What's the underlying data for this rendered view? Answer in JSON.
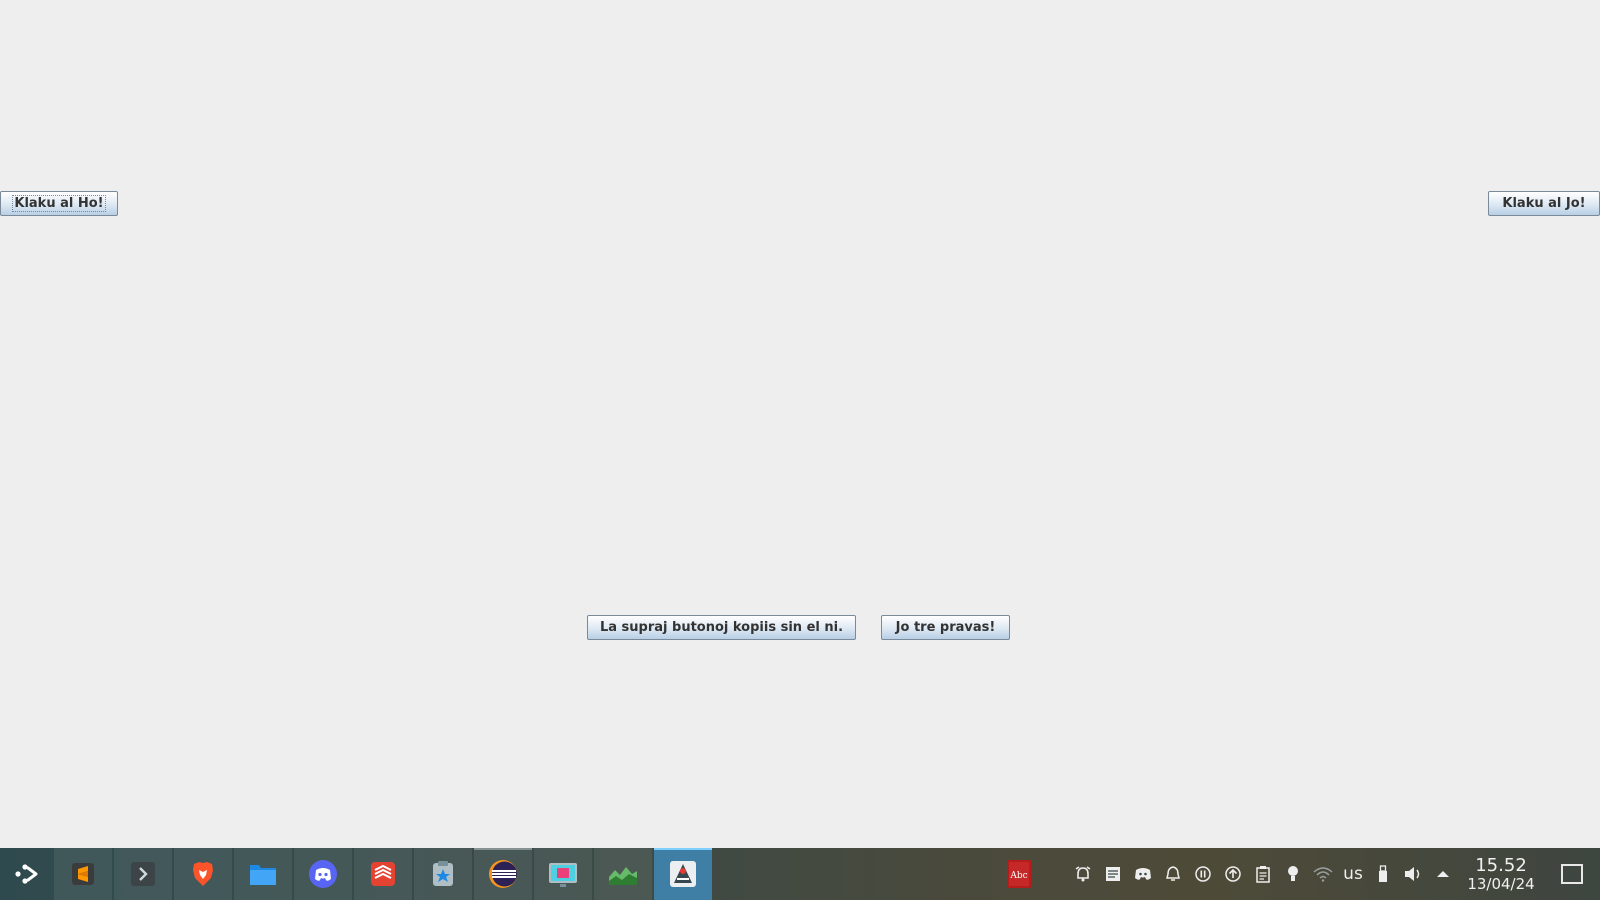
{
  "window": {
    "buttons": {
      "ho": "Klaku al Ho!",
      "jo": "Klaku al Jo!",
      "copy": "La supraj butonoj kopiis sin el ni.",
      "right": "Jo tre pravas!"
    }
  },
  "taskbar": {
    "launcher_icon": "application-launcher-icon",
    "tasks": [
      {
        "icon": "sublime-text-icon",
        "running": false,
        "active": false
      },
      {
        "icon": "terminal-icon",
        "running": false,
        "active": false
      },
      {
        "icon": "brave-browser-icon",
        "running": false,
        "active": false
      },
      {
        "icon": "file-manager-icon",
        "running": false,
        "active": false
      },
      {
        "icon": "discord-icon",
        "running": false,
        "active": false
      },
      {
        "icon": "todoist-icon",
        "running": false,
        "active": false
      },
      {
        "icon": "bookmark-app-icon",
        "running": false,
        "active": false
      },
      {
        "icon": "eclipse-icon",
        "running": true,
        "active": false
      },
      {
        "icon": "screenshot-tool-icon",
        "running": false,
        "active": false
      },
      {
        "icon": "system-monitor-icon",
        "running": false,
        "active": false
      },
      {
        "icon": "java-app-icon",
        "running": true,
        "active": true
      }
    ],
    "tray": {
      "app_icon": "dictionary-abc-icon",
      "icons": [
        "alarm-icon",
        "notes-icon",
        "discord-tray-icon",
        "notifications-icon",
        "pause-icon",
        "update-icon",
        "clipboard-icon",
        "lightbulb-icon",
        "wifi-icon"
      ],
      "keyboard_layout": "us",
      "icons_after": [
        "usb-drive-icon",
        "volume-icon",
        "expand-tray-icon"
      ],
      "time": "15.52",
      "date": "13/04/24"
    },
    "show_desktop_icon": "show-desktop-icon"
  },
  "colors": {
    "window_bg": "#eeeeee",
    "active_task": "#3f7fa6",
    "button_border": "#7a8a99"
  }
}
